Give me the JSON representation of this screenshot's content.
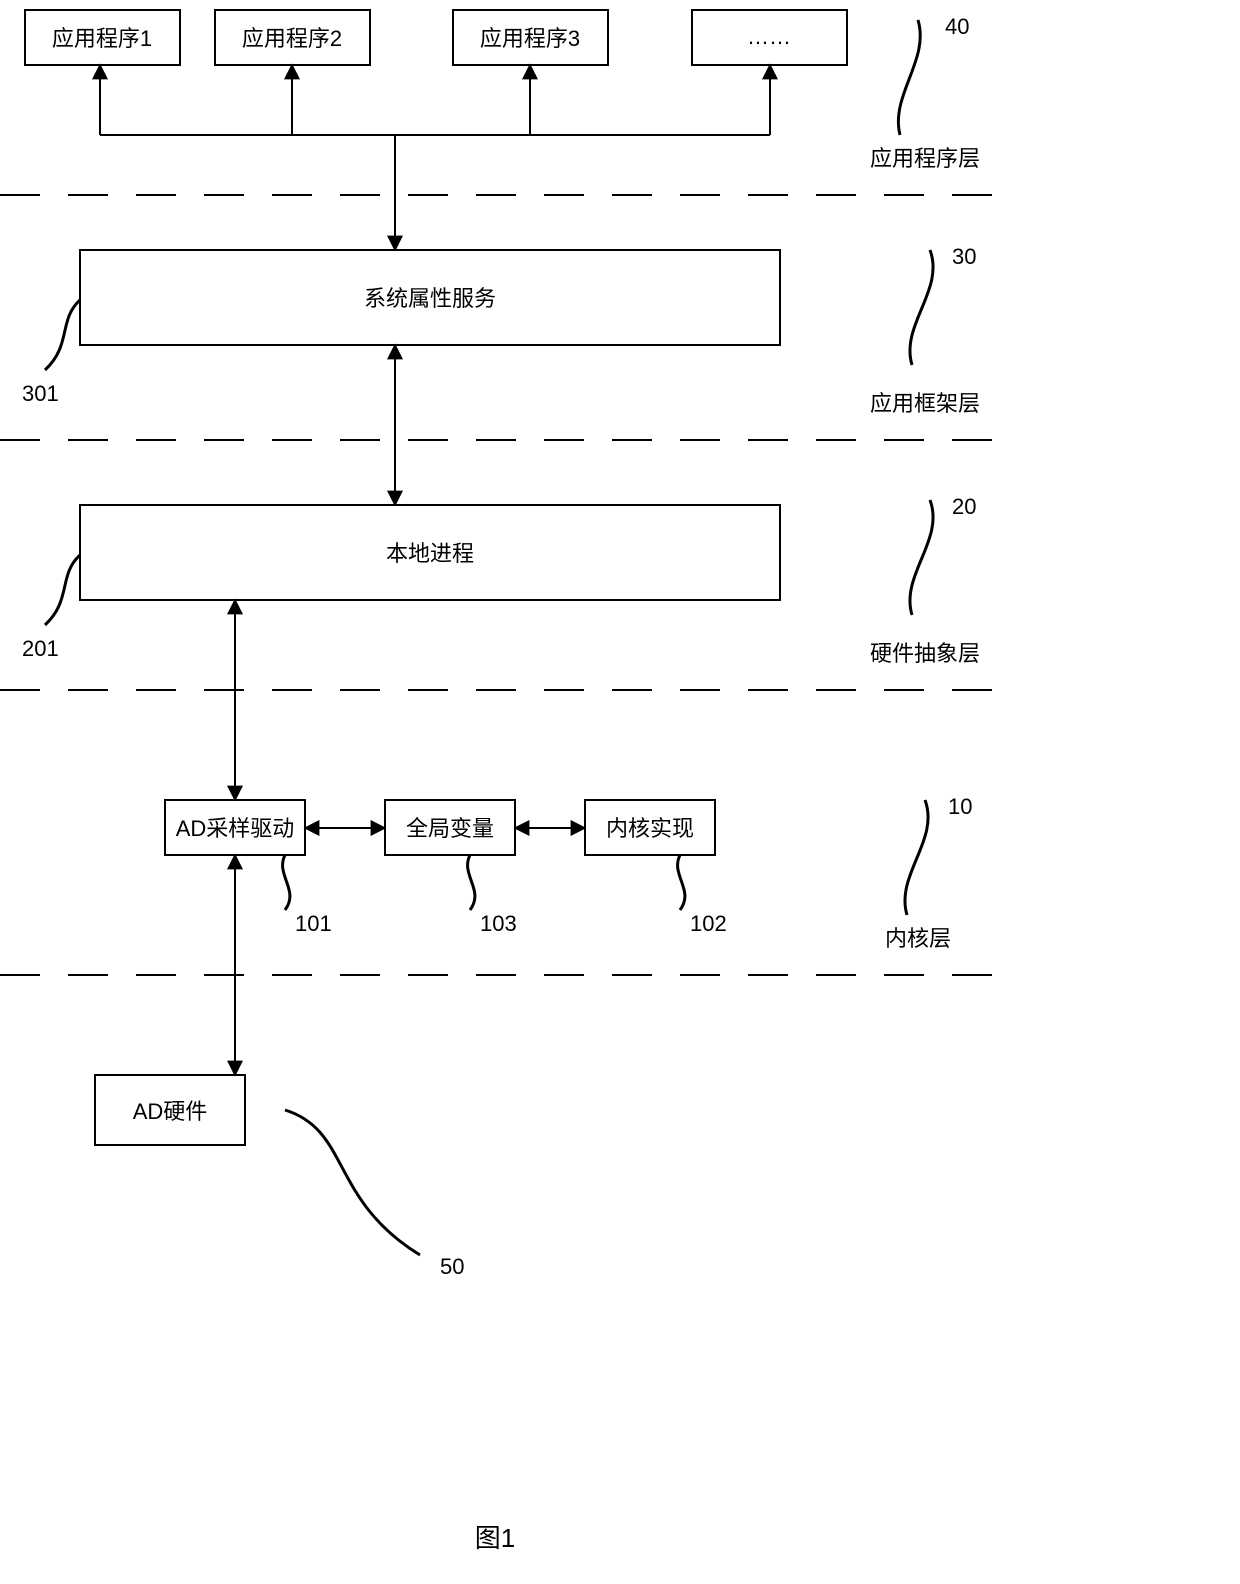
{
  "apps": {
    "app1": "应用程序1",
    "app2": "应用程序2",
    "app3": "应用程序3",
    "more": "……"
  },
  "layers": {
    "app_layer": "应用程序层",
    "framework_layer": "应用框架层",
    "hal_layer": "硬件抽象层",
    "kernel_layer": "内核层"
  },
  "blocks": {
    "system_property_service": "系统属性服务",
    "local_process": "本地进程",
    "ad_sampling_driver": "AD采样驱动",
    "global_variable": "全局变量",
    "kernel_impl": "内核实现",
    "ad_hardware": "AD硬件"
  },
  "refs": {
    "r40": "40",
    "r30": "30",
    "r301": "301",
    "r20": "20",
    "r201": "201",
    "r10": "10",
    "r101": "101",
    "r102": "102",
    "r103": "103",
    "r50": "50"
  },
  "figure": "图1"
}
